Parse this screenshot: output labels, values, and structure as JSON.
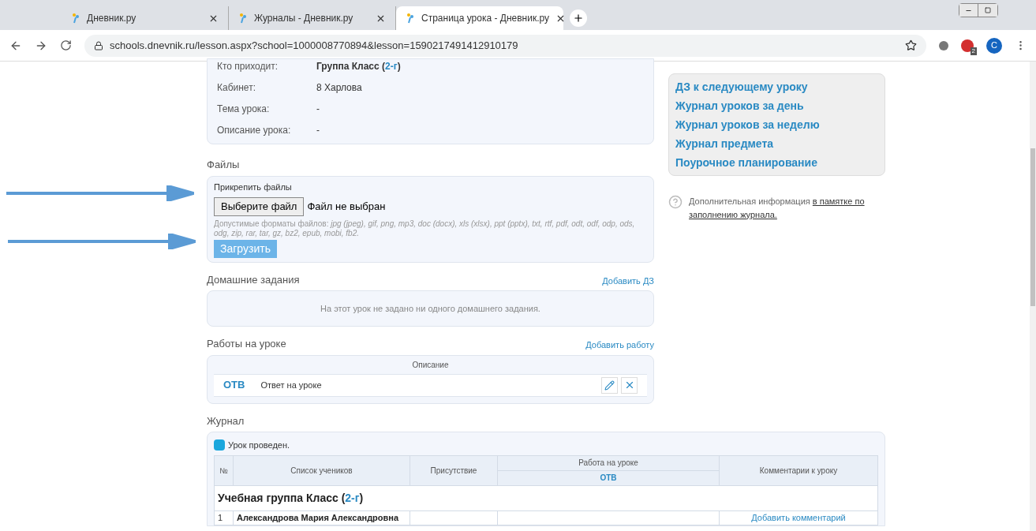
{
  "browser": {
    "tabs": [
      {
        "title": "Дневник.ру",
        "selected": false
      },
      {
        "title": "Журналы - Дневник.ру",
        "selected": false
      },
      {
        "title": "Страница урока - Дневник.ру",
        "selected": true
      }
    ],
    "url": "schools.dnevnik.ru/lesson.aspx?school=1000008770894&lesson=1590217491412910179",
    "profile_initial": "C",
    "extension_badge": "2"
  },
  "lesson_info": [
    {
      "label": "Кто приходит:",
      "value": "Группа Класс (",
      "group": "2-г",
      "close": ")"
    },
    {
      "label": "Кабинет:",
      "value": "8 Харлова"
    },
    {
      "label": "Тема урока:",
      "value": "-"
    },
    {
      "label": "Описание урока:",
      "value": "-"
    }
  ],
  "files": {
    "title": "Файлы",
    "attach_label": "Прикрепить файлы",
    "choose_button": "Выберите файл",
    "no_file": "Файл не выбран",
    "formats_label": "Допустимые форматы файлов: ",
    "formats": "jpg (jpeg), gif, png, mp3, doc (docx), xls (xlsx), ppt (pptx), txt, rtf, pdf, odt, odf, odp, ods, odg, zip, rar, tar, gz, bz2, epub, mobi, fb2.",
    "upload_button": "Загрузить"
  },
  "homework": {
    "title": "Домашние задания",
    "add_link": "Добавить ДЗ",
    "empty": "На этот урок не задано ни одного домашнего задания."
  },
  "works": {
    "title": "Работы на уроке",
    "add_link": "Добавить работу",
    "column": "Описание",
    "rows": [
      {
        "code": "ОТВ",
        "description": "Ответ на уроке"
      }
    ]
  },
  "journal": {
    "title": "Журнал",
    "legend": "Урок проведен.",
    "columns": [
      "№",
      "Список учеников",
      "Присутствие",
      "Работа на уроке",
      "Комментарии к уроку"
    ],
    "work_columns": [
      "ОТВ"
    ],
    "group_title": "Учебная группа Класс (",
    "group_code": "2-г",
    "group_close": ")",
    "rows": [
      {
        "number": "1",
        "name": "Александрова Мария Александровна",
        "comment_link": "Добавить комментарий"
      }
    ]
  },
  "side_links": [
    "ДЗ к следующему уроку",
    "Журнал уроков за день",
    "Журнал уроков за неделю",
    "Журнал предмета",
    "Поурочное планирование"
  ],
  "help": {
    "text": "Дополнительная информация ",
    "link_lines": [
      "в памятке по",
      "заполнению журнала."
    ]
  }
}
